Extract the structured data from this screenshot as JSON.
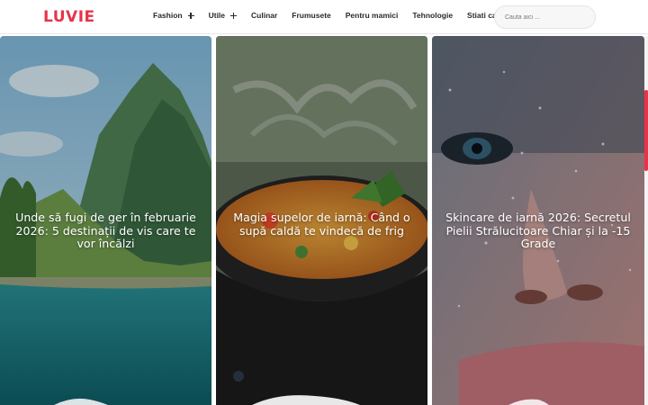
{
  "header": {
    "logo": "LUVIE",
    "nav": [
      {
        "label": "Fashion",
        "has_submenu": true
      },
      {
        "label": "Utile",
        "has_submenu": true
      },
      {
        "label": "Culinar",
        "has_submenu": false
      },
      {
        "label": "Frumusete",
        "has_submenu": false
      },
      {
        "label": "Pentru mamici",
        "has_submenu": false
      },
      {
        "label": "Tehnologie",
        "has_submenu": false
      },
      {
        "label": "Stiati ca",
        "has_submenu": false
      }
    ],
    "search": {
      "placeholder": "Cauta aici ..."
    }
  },
  "articles": [
    {
      "title": "Unde să fugi de ger în februarie 2026: 5 destinații de vis care te vor încălzi",
      "image": "tropical-island-lagoon"
    },
    {
      "title": "Magia supelor de iarnă: Când o supă caldă te vindecă de frig",
      "image": "steaming-soup-bowl"
    },
    {
      "title": "Skincare de iarnă 2026: Secretul Pielii Strălucitoare Chiar și la -15 Grade",
      "image": "glitter-face-closeup"
    }
  ],
  "colors": {
    "accent": "#e8334a",
    "nav_text": "#2a2a2a"
  }
}
